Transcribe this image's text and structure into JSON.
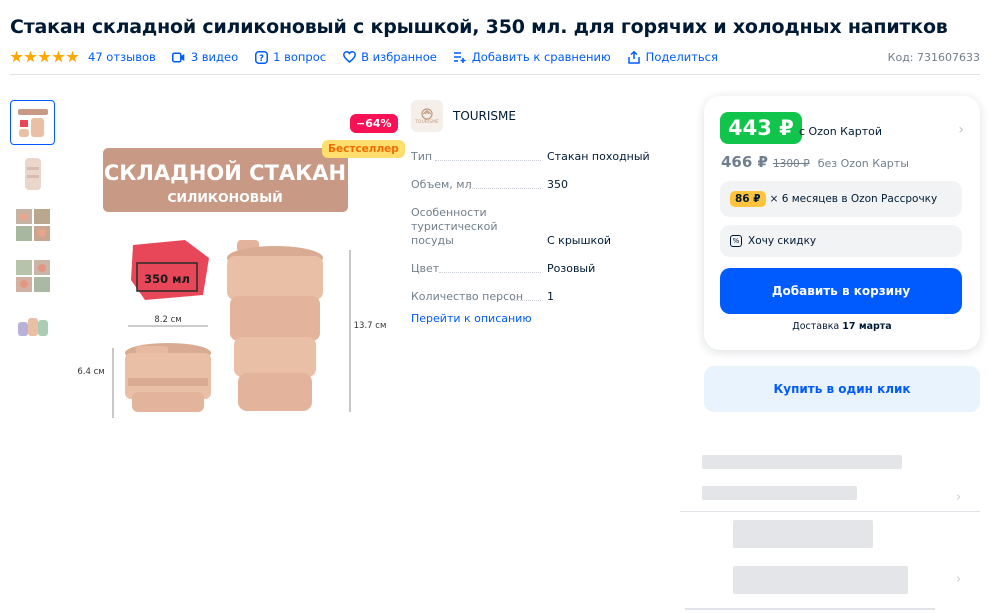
{
  "product": {
    "title": "Стакан складной силиконовый с крышкой, 350 мл. для горячих и холодных напитков",
    "rating_stars": 5,
    "reviews": "47 отзывов",
    "videos": "3 видео",
    "questions": "1 вопрос",
    "favorite": "В избранное",
    "compare": "Добавить к сравнению",
    "share": "Поделиться",
    "sku": "Код: 731607633"
  },
  "gallery": {
    "discount_badge": "−64%",
    "bestseller_badge": "Бестселлер",
    "image_text": {
      "headline": "СКЛАДНОЙ СТАКАН",
      "subheadline": "СИЛИКОНОВЫЙ",
      "volume": "350 мл",
      "width": "8.2 см",
      "height_tall": "13.7 см",
      "height_short": "6.4 см"
    }
  },
  "brand": {
    "name": "TOURISME",
    "logo_text": "TOURISME"
  },
  "specs": [
    {
      "key": "Тип",
      "value": "Стакан походный"
    },
    {
      "key": "Объем, мл",
      "value": "350"
    },
    {
      "key": "Особенности туристической посуды",
      "value": "С крышкой"
    },
    {
      "key": "Цвет",
      "value": "Розовый"
    },
    {
      "key": "Количество персон",
      "value": "1"
    }
  ],
  "goto_description": "Перейти к описанию",
  "buy_card": {
    "price_card": "443 ₽",
    "price_card_note": "с Ozon Картой",
    "price_regular": "466 ₽",
    "price_old": "1300 ₽",
    "price_regular_note": "без Ozon Карты",
    "installment_amount": "86 ₽",
    "installment_text": "× 6 месяцев в Ozon Рассрочку",
    "want_discount": "Хочу скидку",
    "add_to_cart": "Добавить в корзину",
    "delivery_label": "Доставка",
    "delivery_date": "17 марта",
    "one_click": "Купить в один клик"
  },
  "colors": {
    "accent": "#005bff",
    "price_green": "#10c44c",
    "discount_red": "#f91155",
    "star": "#ffa800",
    "installment_yellow": "#ffc43b",
    "product_pink": "#e9bfa5"
  }
}
